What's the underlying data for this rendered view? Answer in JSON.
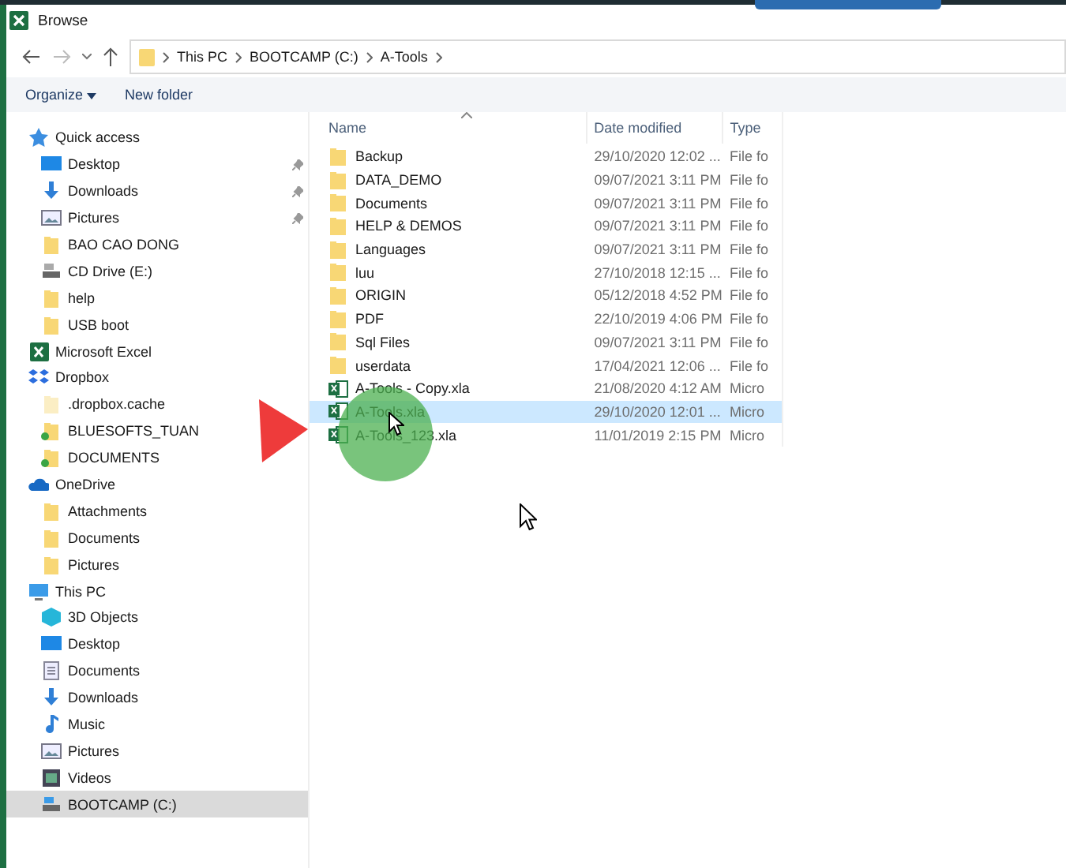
{
  "window": {
    "title": "Browse"
  },
  "address": {
    "segments": [
      "This PC",
      "BOOTCAMP (C:)",
      "A-Tools"
    ]
  },
  "toolbar": {
    "organize": "Organize",
    "new_folder": "New folder"
  },
  "sidebar": {
    "groups": [
      {
        "label": "Quick access",
        "kind": "quick",
        "selected": false,
        "children": [
          {
            "label": "Desktop",
            "kind": "desktop",
            "pinned": true,
            "selected": false
          },
          {
            "label": "Downloads",
            "kind": "downloads",
            "pinned": true,
            "selected": false
          },
          {
            "label": "Pictures",
            "kind": "pictures",
            "pinned": true,
            "selected": false
          },
          {
            "label": "BAO CAO DONG",
            "kind": "folder",
            "pinned": false,
            "selected": false
          },
          {
            "label": "CD Drive (E:)",
            "kind": "cd",
            "pinned": false,
            "selected": false
          },
          {
            "label": "help",
            "kind": "folder",
            "pinned": false,
            "selected": false
          },
          {
            "label": "USB boot",
            "kind": "folder",
            "pinned": false,
            "selected": false
          }
        ]
      },
      {
        "label": "Microsoft Excel",
        "kind": "excel",
        "selected": false
      },
      {
        "label": "Dropbox",
        "kind": "dropbox",
        "selected": false,
        "children": [
          {
            "label": ".dropbox.cache",
            "kind": "folder-faded",
            "pinned": false,
            "selected": false
          },
          {
            "label": "BLUESOFTS_TUAN",
            "kind": "folder-synced",
            "pinned": false,
            "selected": false
          },
          {
            "label": "DOCUMENTS",
            "kind": "folder-synced",
            "pinned": false,
            "selected": false
          }
        ]
      },
      {
        "label": "OneDrive",
        "kind": "onedrive",
        "selected": false,
        "children": [
          {
            "label": "Attachments",
            "kind": "folder",
            "pinned": false,
            "selected": false
          },
          {
            "label": "Documents",
            "kind": "folder",
            "pinned": false,
            "selected": false
          },
          {
            "label": "Pictures",
            "kind": "folder",
            "pinned": false,
            "selected": false
          }
        ]
      },
      {
        "label": "This PC",
        "kind": "pc",
        "selected": false,
        "children": [
          {
            "label": "3D Objects",
            "kind": "cube",
            "pinned": false,
            "selected": false
          },
          {
            "label": "Desktop",
            "kind": "desktop",
            "pinned": false,
            "selected": false
          },
          {
            "label": "Documents",
            "kind": "documents",
            "pinned": false,
            "selected": false
          },
          {
            "label": "Downloads",
            "kind": "downloads",
            "pinned": false,
            "selected": false
          },
          {
            "label": "Music",
            "kind": "music",
            "pinned": false,
            "selected": false
          },
          {
            "label": "Pictures",
            "kind": "pictures",
            "pinned": false,
            "selected": false
          },
          {
            "label": "Videos",
            "kind": "videos",
            "pinned": false,
            "selected": false
          },
          {
            "label": "BOOTCAMP (C:)",
            "kind": "drive",
            "pinned": false,
            "selected": true
          }
        ]
      }
    ]
  },
  "table": {
    "columns": [
      "Name",
      "Date modified",
      "Type"
    ],
    "rows": [
      {
        "name": "Backup",
        "date": "29/10/2020 12:02 ...",
        "type": "File fo",
        "kind": "folder",
        "selected": false
      },
      {
        "name": "DATA_DEMO",
        "date": "09/07/2021 3:11 PM",
        "type": "File fo",
        "kind": "folder",
        "selected": false
      },
      {
        "name": "Documents",
        "date": "09/07/2021 3:11 PM",
        "type": "File fo",
        "kind": "folder",
        "selected": false
      },
      {
        "name": "HELP & DEMOS",
        "date": "09/07/2021 3:11 PM",
        "type": "File fo",
        "kind": "folder",
        "selected": false
      },
      {
        "name": "Languages",
        "date": "09/07/2021 3:11 PM",
        "type": "File fo",
        "kind": "folder",
        "selected": false
      },
      {
        "name": "luu",
        "date": "27/10/2018 12:15 ...",
        "type": "File fo",
        "kind": "folder",
        "selected": false
      },
      {
        "name": "ORIGIN",
        "date": "05/12/2018 4:52 PM",
        "type": "File fo",
        "kind": "folder",
        "selected": false
      },
      {
        "name": "PDF",
        "date": "22/10/2019 4:06 PM",
        "type": "File fo",
        "kind": "folder",
        "selected": false
      },
      {
        "name": "Sql Files",
        "date": "09/07/2021 3:11 PM",
        "type": "File fo",
        "kind": "folder",
        "selected": false
      },
      {
        "name": "userdata",
        "date": "17/04/2021 12:06 ...",
        "type": "File fo",
        "kind": "folder",
        "selected": false
      },
      {
        "name": "A-Tools - Copy.xla",
        "date": "21/08/2020 4:12 AM",
        "type": "Micro",
        "kind": "excel",
        "selected": false
      },
      {
        "name": "A-Tools.xla",
        "date": "29/10/2020 12:01 ...",
        "type": "Micro",
        "kind": "excel",
        "selected": true
      },
      {
        "name": "A-Tools_123.xla",
        "date": "11/01/2019 2:15 PM",
        "type": "Micro",
        "kind": "excel",
        "selected": false
      }
    ]
  }
}
